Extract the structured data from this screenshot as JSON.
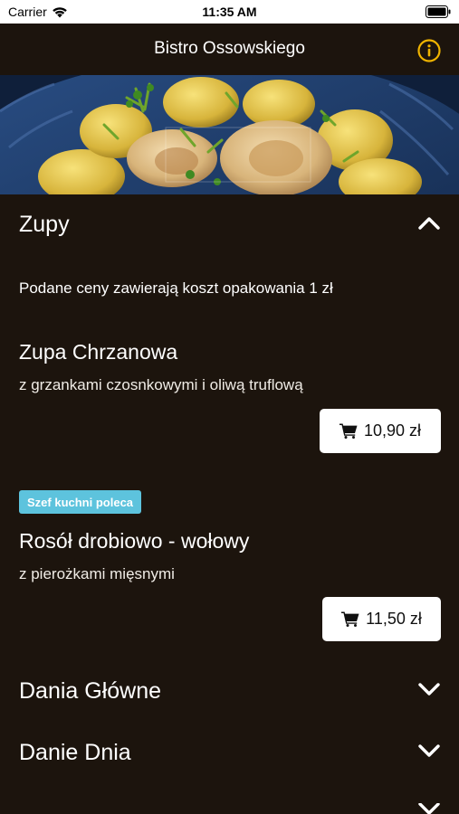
{
  "status": {
    "carrier": "Carrier",
    "time": "11:35 AM"
  },
  "nav": {
    "title": "Bistro Ossowskiego",
    "info_icon": "info-circle-icon",
    "accent": "#f0b400"
  },
  "sections": [
    {
      "name": "Zupy",
      "expanded": true,
      "note": "Podane ceny zawierają koszt opakowania 1 zł",
      "items": [
        {
          "title": "Zupa Chrzanowa",
          "description": "z grzankami czosnkowymi i oliwą truflową",
          "price": "10,90 zł"
        },
        {
          "badge": "Szef kuchni poleca",
          "title": "Rosół drobiowo - wołowy",
          "description": "z pierożkami mięsnymi",
          "price": "11,50 zł"
        }
      ]
    },
    {
      "name": "Dania Główne",
      "expanded": false
    },
    {
      "name": "Danie Dnia",
      "expanded": false
    }
  ],
  "colors": {
    "background": "#1c140d",
    "badge": "#5dc3dd"
  }
}
